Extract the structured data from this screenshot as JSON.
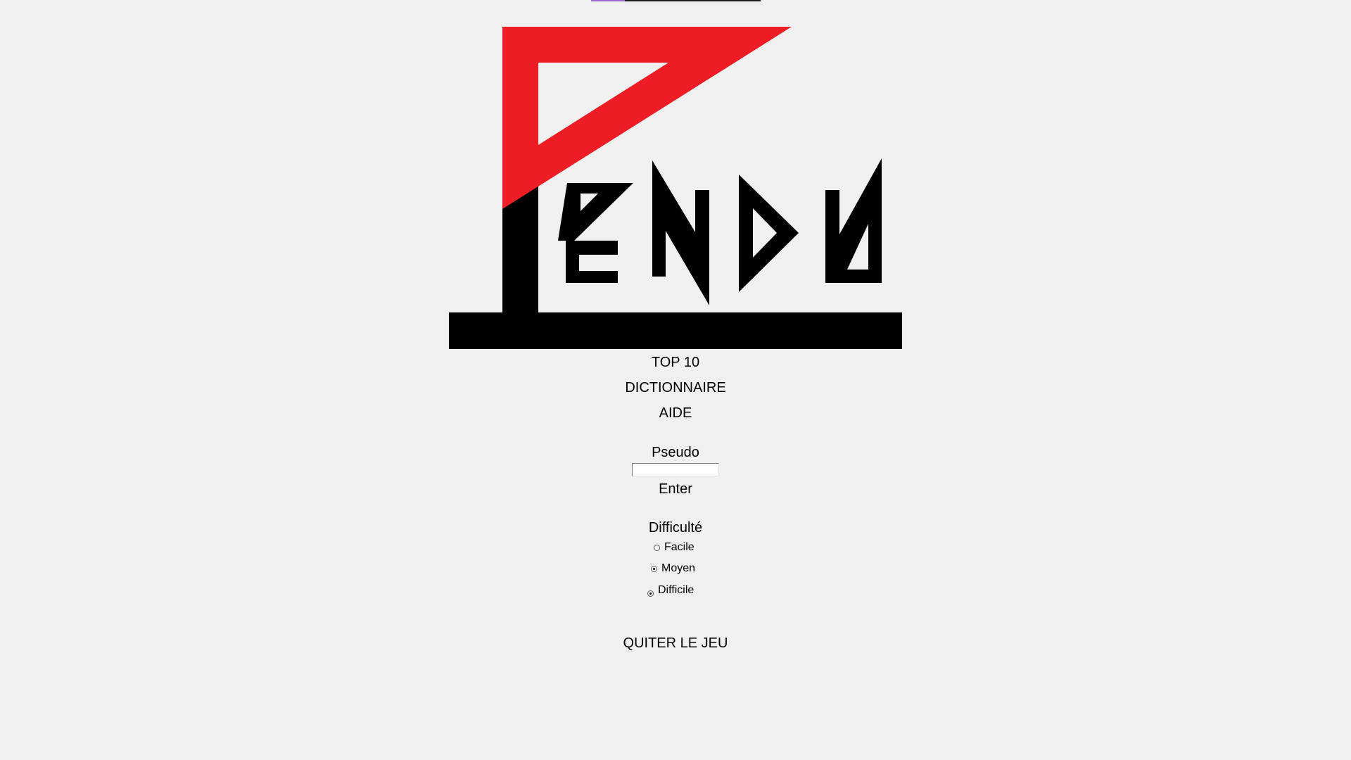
{
  "colors": {
    "background": "#f0f0f0",
    "logo_red": "#ee1c25",
    "logo_black": "#000000"
  },
  "logo": {
    "text": "PENDU"
  },
  "menu": {
    "top10": "TOP 10",
    "dictionnaire": "DICTIONNAIRE",
    "aide": "AIDE"
  },
  "pseudo": {
    "label": "Pseudo",
    "value": "",
    "enter_label": "Enter"
  },
  "difficulty": {
    "label": "Difficulté",
    "options": [
      {
        "label": "Facile",
        "checked": false
      },
      {
        "label": "Moyen",
        "checked": true
      },
      {
        "label": "Difficile",
        "checked": true
      }
    ]
  },
  "quit": {
    "label": "QUITER LE JEU"
  }
}
